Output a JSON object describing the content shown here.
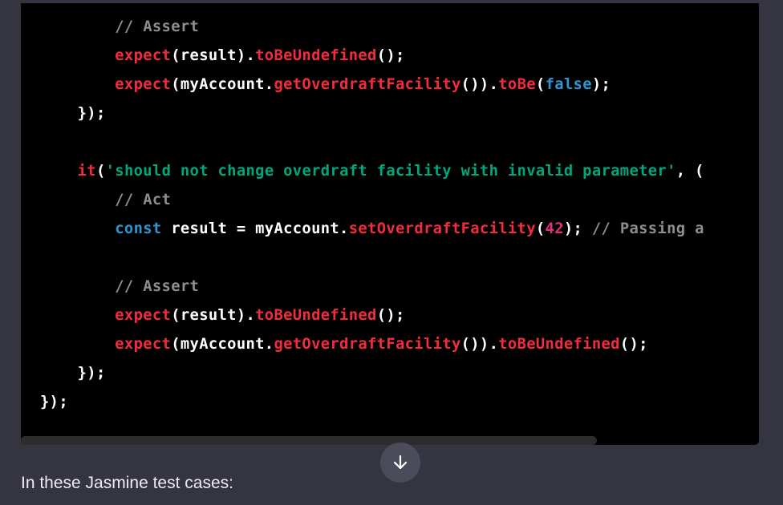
{
  "code_block": {
    "lines": [
      [
        {
          "t": "        ",
          "c": "plain"
        },
        {
          "t": "// Assert",
          "c": "comment"
        }
      ],
      [
        {
          "t": "        ",
          "c": "plain"
        },
        {
          "t": "expect",
          "c": "fn"
        },
        {
          "t": "(result).",
          "c": "plain"
        },
        {
          "t": "toBeUndefined",
          "c": "fn"
        },
        {
          "t": "();",
          "c": "plain"
        }
      ],
      [
        {
          "t": "        ",
          "c": "plain"
        },
        {
          "t": "expect",
          "c": "fn"
        },
        {
          "t": "(myAccount.",
          "c": "plain"
        },
        {
          "t": "getOverdraftFacility",
          "c": "fn"
        },
        {
          "t": "()).",
          "c": "plain"
        },
        {
          "t": "toBe",
          "c": "fn"
        },
        {
          "t": "(",
          "c": "plain"
        },
        {
          "t": "false",
          "c": "kw"
        },
        {
          "t": ");",
          "c": "plain"
        }
      ],
      [
        {
          "t": "    });",
          "c": "plain"
        }
      ],
      [],
      [
        {
          "t": "    ",
          "c": "plain"
        },
        {
          "t": "it",
          "c": "fn"
        },
        {
          "t": "(",
          "c": "plain"
        },
        {
          "t": "'should not change overdraft facility with invalid parameter'",
          "c": "str"
        },
        {
          "t": ", (",
          "c": "plain"
        }
      ],
      [
        {
          "t": "        ",
          "c": "plain"
        },
        {
          "t": "// Act",
          "c": "comment"
        }
      ],
      [
        {
          "t": "        ",
          "c": "plain"
        },
        {
          "t": "const",
          "c": "kw"
        },
        {
          "t": " result = myAccount.",
          "c": "plain"
        },
        {
          "t": "setOverdraftFacility",
          "c": "fn"
        },
        {
          "t": "(",
          "c": "plain"
        },
        {
          "t": "42",
          "c": "num"
        },
        {
          "t": "); ",
          "c": "plain"
        },
        {
          "t": "// Passing a",
          "c": "comment"
        }
      ],
      [],
      [
        {
          "t": "        ",
          "c": "plain"
        },
        {
          "t": "// Assert",
          "c": "comment"
        }
      ],
      [
        {
          "t": "        ",
          "c": "plain"
        },
        {
          "t": "expect",
          "c": "fn"
        },
        {
          "t": "(result).",
          "c": "plain"
        },
        {
          "t": "toBeUndefined",
          "c": "fn"
        },
        {
          "t": "();",
          "c": "plain"
        }
      ],
      [
        {
          "t": "        ",
          "c": "plain"
        },
        {
          "t": "expect",
          "c": "fn"
        },
        {
          "t": "(myAccount.",
          "c": "plain"
        },
        {
          "t": "getOverdraftFacility",
          "c": "fn"
        },
        {
          "t": "()).",
          "c": "plain"
        },
        {
          "t": "toBeUndefined",
          "c": "fn"
        },
        {
          "t": "();",
          "c": "plain"
        }
      ],
      [
        {
          "t": "    });",
          "c": "plain"
        }
      ],
      [
        {
          "t": "});",
          "c": "plain"
        }
      ]
    ],
    "horizontal_scroll_fraction": 0.78
  },
  "scroll_button": {
    "icon": "arrow-down-icon"
  },
  "message": {
    "text": "In these Jasmine test cases:"
  },
  "colors": {
    "page_background": "#343541",
    "code_background": "#000000",
    "comment": "#8e8e8e",
    "function": "#f22c3d",
    "string": "#00a67d",
    "keyword": "#2e95d3",
    "number": "#df3079",
    "plain": "#ffffff"
  }
}
